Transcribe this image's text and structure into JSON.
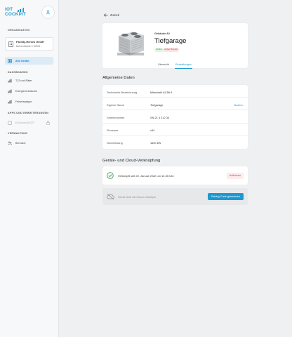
{
  "brand": {
    "line1": "IOT",
    "line2": "COCKPIT",
    "color": "#1e98d0"
  },
  "sidebar": {
    "org_section": "ORGANISATION",
    "org": {
      "name": "Facility-Heroes GmbH",
      "address": "Bahnhofstraße 5, 58313..."
    },
    "devices_label": "Alle Geräte",
    "dash_section": "DASHBOARDS",
    "dashboards": [
      "TJZ und Räter",
      "Energieverbräuche",
      "Fehleranalyse"
    ],
    "apps_section": "APPS UND ERWEITERUNGEN",
    "apps": [
      "EnOcean2MQTT"
    ],
    "admin_section": "VERWALTUNG",
    "admin": [
      "Benutzer"
    ]
  },
  "nav": {
    "back_label": "Zurück"
  },
  "device": {
    "location": "Gebäude A2",
    "name": "Tiefgarage",
    "status_online": "Online",
    "status_alarm": "Außer Betrieb",
    "tabs": [
      "Übersicht",
      "Einstellungen"
    ],
    "active_tab": 1
  },
  "general": {
    "heading": "Allgemeine Daten",
    "rows": [
      {
        "key": "Technische Bezeichnung",
        "value": "Mitsubishi AC56.4",
        "action": ""
      },
      {
        "key": "Eigener Name",
        "value": "Tiefgarage",
        "action": "Ändern"
      },
      {
        "key": "Seriennummer",
        "value": "SN 21 4 212 33",
        "action": ""
      },
      {
        "key": "Firmware",
        "value": "v34",
        "action": ""
      },
      {
        "key": "Nennleistung",
        "value": "1600 kW",
        "action": ""
      }
    ]
  },
  "cloud_link": {
    "heading": "Geräte- und Cloud-Verknüpfung",
    "linked_text": "Verknüpft seit 20. Januar 2022 um 14:45 Uhr.",
    "unlink_label": "Aufheben",
    "not_linked_text": "Gerät nicht mit Cloud verknüpft.",
    "pairing_label": "Pairing Code generieren"
  },
  "colors": {
    "accent": "#1e98d0",
    "online": "#3a9d48",
    "alarm": "#d04545"
  }
}
